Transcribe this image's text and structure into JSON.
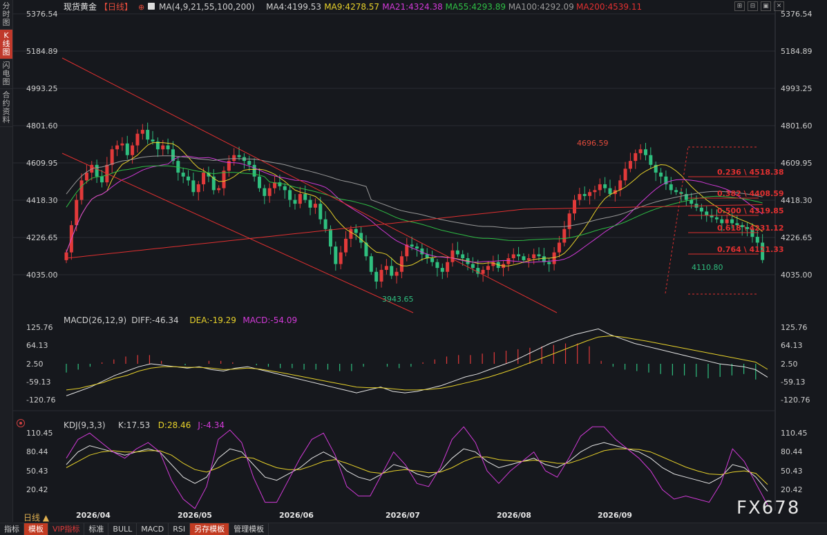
{
  "sidebar": {
    "items": [
      {
        "label": "分时图",
        "active": false
      },
      {
        "label": "K线图",
        "active": true
      },
      {
        "label": "闪电图",
        "active": false
      },
      {
        "label": "合约资料",
        "active": false
      }
    ]
  },
  "header": {
    "symbol": "现货黄金",
    "period_tag": "【日线】",
    "ma_items": [
      {
        "text": "MA(4,9,21,55,100,200)",
        "color": "#cfcfcf"
      },
      {
        "text": "MA4:4199.53",
        "color": "#cfcfcf"
      },
      {
        "text": "MA9:4278.57",
        "color": "#e8d22a"
      },
      {
        "text": "MA21:4324.38",
        "color": "#d23ad8"
      },
      {
        "text": "MA55:4293.89",
        "color": "#2fbf45"
      },
      {
        "text": "MA100:4292.09",
        "color": "#9a9a9a"
      },
      {
        "text": "MA200:4539.11",
        "color": "#e23030"
      }
    ]
  },
  "window_controls": [
    "⊞",
    "⊟",
    "▣",
    "✕"
  ],
  "macd_header": [
    {
      "text": "MACD(26,12,9)",
      "color": "#cfcfcf"
    },
    {
      "text": "DIFF:-46.34",
      "color": "#cfcfcf"
    },
    {
      "text": "DEA:-19.29",
      "color": "#e8d22a"
    },
    {
      "text": "MACD:-54.09",
      "color": "#d23ad8"
    }
  ],
  "kdj_header": [
    {
      "text": "KDJ(9,3,3)",
      "color": "#cfcfcf"
    },
    {
      "text": "K:17.53",
      "color": "#cfcfcf"
    },
    {
      "text": "D:28.46",
      "color": "#e8d22a"
    },
    {
      "text": "J:-4.34",
      "color": "#d23ad8"
    }
  ],
  "bottom_bar": {
    "period": "日线 ▲",
    "buttons": [
      "指标",
      "模板",
      "VIP指标",
      "标准",
      "BULL",
      "MACD",
      "RSI",
      "另存模板",
      "管理模板"
    ]
  },
  "watermark": "FX678",
  "colors": {
    "up": "#e23a3a",
    "down": "#2fbf7f",
    "bg": "#16181d",
    "grid": "#2a2c32"
  },
  "chart_data": [
    {
      "type": "candlestick",
      "title": "现货黄金【日线】",
      "ylim": [
        3943.65,
        4801.6
      ],
      "ytick_labels": [
        "5376.54",
        "5184.89",
        "4993.25",
        "4801.60",
        "4609.95",
        "4418.30",
        "4226.65",
        "4035.00"
      ],
      "xtick_labels": [
        "2026/04",
        "2026/05",
        "2026/06",
        "2026/07",
        "2026/08",
        "2026/09"
      ],
      "annotations": [
        {
          "label": "4696.59",
          "kind": "high"
        },
        {
          "label": "3943.65",
          "kind": "low"
        },
        {
          "label": "4110.80",
          "kind": "last"
        }
      ],
      "fibonacci": [
        {
          "label": "0.236 \\ 4518.38",
          "value": 4518.38
        },
        {
          "label": "0.382 \\ 4408.59",
          "value": 4408.59
        },
        {
          "label": "0.500 \\ 4319.85",
          "value": 4319.85
        },
        {
          "label": "0.618 \\ 4231.12",
          "value": 4231.12
        },
        {
          "label": "0.764 \\ 4121.33",
          "value": 4121.33
        }
      ],
      "closes": [
        4150,
        4290,
        4420,
        4520,
        4560,
        4600,
        4540,
        4510,
        4600,
        4680,
        4700,
        4710,
        4650,
        4700,
        4760,
        4780,
        4730,
        4720,
        4680,
        4700,
        4680,
        4620,
        4560,
        4540,
        4520,
        4460,
        4500,
        4560,
        4540,
        4470,
        4480,
        4570,
        4620,
        4650,
        4640,
        4620,
        4600,
        4540,
        4480,
        4440,
        4480,
        4510,
        4490,
        4470,
        4420,
        4400,
        4450,
        4420,
        4380,
        4400,
        4320,
        4270,
        4180,
        4090,
        4150,
        4220,
        4270,
        4250,
        4200,
        4130,
        4050,
        4000,
        4060,
        4080,
        4030,
        4050,
        4130,
        4190,
        4180,
        4170,
        4140,
        4120,
        4100,
        4070,
        4050,
        4100,
        4160,
        4140,
        4120,
        4090,
        4070,
        4040,
        4060,
        4080,
        4100,
        4070,
        4090,
        4120,
        4140,
        4130,
        4110,
        4120,
        4140,
        4130,
        4100,
        4090,
        4150,
        4200,
        4270,
        4350,
        4420,
        4450,
        4440,
        4460,
        4470,
        4500,
        4480,
        4450,
        4470,
        4520,
        4580,
        4620,
        4660,
        4680,
        4650,
        4600,
        4560,
        4540,
        4500,
        4470,
        4460,
        4450,
        4420,
        4400,
        4380,
        4360,
        4340,
        4330,
        4320,
        4300,
        4320,
        4300,
        4290,
        4280,
        4270,
        4230,
        4200,
        4110.8
      ],
      "series": [
        {
          "name": "MA9",
          "color": "#e8d22a",
          "period": 9
        },
        {
          "name": "MA21",
          "color": "#d23ad8",
          "period": 21
        },
        {
          "name": "MA55",
          "color": "#2fbf45",
          "period": 55
        },
        {
          "name": "MA100",
          "color": "#9a9a9a",
          "period": 100
        },
        {
          "name": "MA200",
          "color": "#e23030",
          "period": 200
        }
      ]
    },
    {
      "type": "bar",
      "title": "MACD(26,12,9)",
      "ytick_labels": [
        "125.76",
        "64.13",
        "2.50",
        "-59.13",
        "-120.76"
      ],
      "ylim": [
        -120.76,
        125.76
      ],
      "diff": [
        -110,
        -95,
        -80,
        -60,
        -40,
        -25,
        -10,
        0,
        -5,
        -10,
        -15,
        -10,
        -20,
        -25,
        -15,
        -10,
        -20,
        -30,
        -40,
        -50,
        -60,
        -70,
        -80,
        -90,
        -100,
        -90,
        -80,
        -95,
        -100,
        -95,
        -85,
        -75,
        -60,
        -45,
        -35,
        -20,
        -5,
        10,
        30,
        50,
        70,
        85,
        100,
        110,
        120,
        100,
        85,
        70,
        60,
        50,
        40,
        30,
        20,
        10,
        0,
        -5,
        -10,
        -20,
        -46
      ],
      "dea": [
        -90,
        -85,
        -75,
        -65,
        -50,
        -40,
        -25,
        -15,
        -10,
        -10,
        -12,
        -12,
        -15,
        -20,
        -18,
        -15,
        -18,
        -25,
        -32,
        -40,
        -48,
        -56,
        -64,
        -72,
        -80,
        -82,
        -82,
        -86,
        -90,
        -90,
        -88,
        -84,
        -76,
        -66,
        -56,
        -45,
        -32,
        -18,
        -2,
        14,
        30,
        46,
        62,
        78,
        92,
        96,
        92,
        85,
        78,
        70,
        62,
        54,
        46,
        38,
        30,
        22,
        14,
        6,
        -19
      ],
      "hist": [
        -30,
        -20,
        -10,
        5,
        15,
        25,
        30,
        30,
        10,
        0,
        -5,
        0,
        10,
        10,
        5,
        0,
        -5,
        -10,
        -15,
        -15,
        -20,
        -20,
        -20,
        -25,
        -25,
        -10,
        0,
        -10,
        -15,
        -10,
        5,
        15,
        25,
        30,
        30,
        35,
        40,
        45,
        50,
        55,
        60,
        65,
        70,
        70,
        60,
        10,
        -10,
        -20,
        -25,
        -30,
        -35,
        -40,
        -40,
        -45,
        -50,
        -45,
        -40,
        -35,
        -54
      ]
    },
    {
      "type": "line",
      "title": "KDJ(9,3,3)",
      "ytick_labels": [
        "110.45",
        "80.44",
        "50.43",
        "20.42"
      ],
      "ylim": [
        20.42,
        110.45
      ],
      "k": [
        60,
        80,
        90,
        85,
        80,
        75,
        80,
        85,
        80,
        60,
        40,
        30,
        40,
        70,
        85,
        80,
        60,
        40,
        35,
        45,
        55,
        70,
        80,
        70,
        50,
        40,
        35,
        45,
        60,
        55,
        45,
        40,
        50,
        70,
        85,
        80,
        65,
        55,
        60,
        65,
        70,
        60,
        55,
        65,
        80,
        90,
        95,
        90,
        85,
        80,
        70,
        55,
        45,
        40,
        35,
        30,
        40,
        60,
        55,
        40,
        17.53
      ],
      "d": [
        55,
        65,
        75,
        80,
        82,
        80,
        80,
        82,
        82,
        75,
        62,
        52,
        48,
        55,
        65,
        72,
        70,
        62,
        55,
        52,
        52,
        58,
        65,
        68,
        62,
        55,
        48,
        46,
        50,
        52,
        50,
        47,
        48,
        55,
        65,
        72,
        72,
        68,
        66,
        65,
        67,
        65,
        62,
        62,
        68,
        75,
        82,
        85,
        85,
        84,
        80,
        72,
        64,
        56,
        50,
        45,
        44,
        48,
        50,
        46,
        28.46
      ],
      "j": [
        70,
        100,
        110,
        95,
        80,
        70,
        85,
        95,
        80,
        35,
        5,
        -10,
        25,
        100,
        115,
        95,
        40,
        0,
        0,
        35,
        70,
        100,
        110,
        75,
        25,
        10,
        10,
        45,
        80,
        60,
        30,
        25,
        55,
        100,
        120,
        95,
        50,
        30,
        50,
        65,
        80,
        50,
        40,
        70,
        105,
        120,
        120,
        100,
        85,
        70,
        50,
        20,
        5,
        10,
        5,
        0,
        30,
        85,
        65,
        30,
        -4.34
      ]
    }
  ]
}
